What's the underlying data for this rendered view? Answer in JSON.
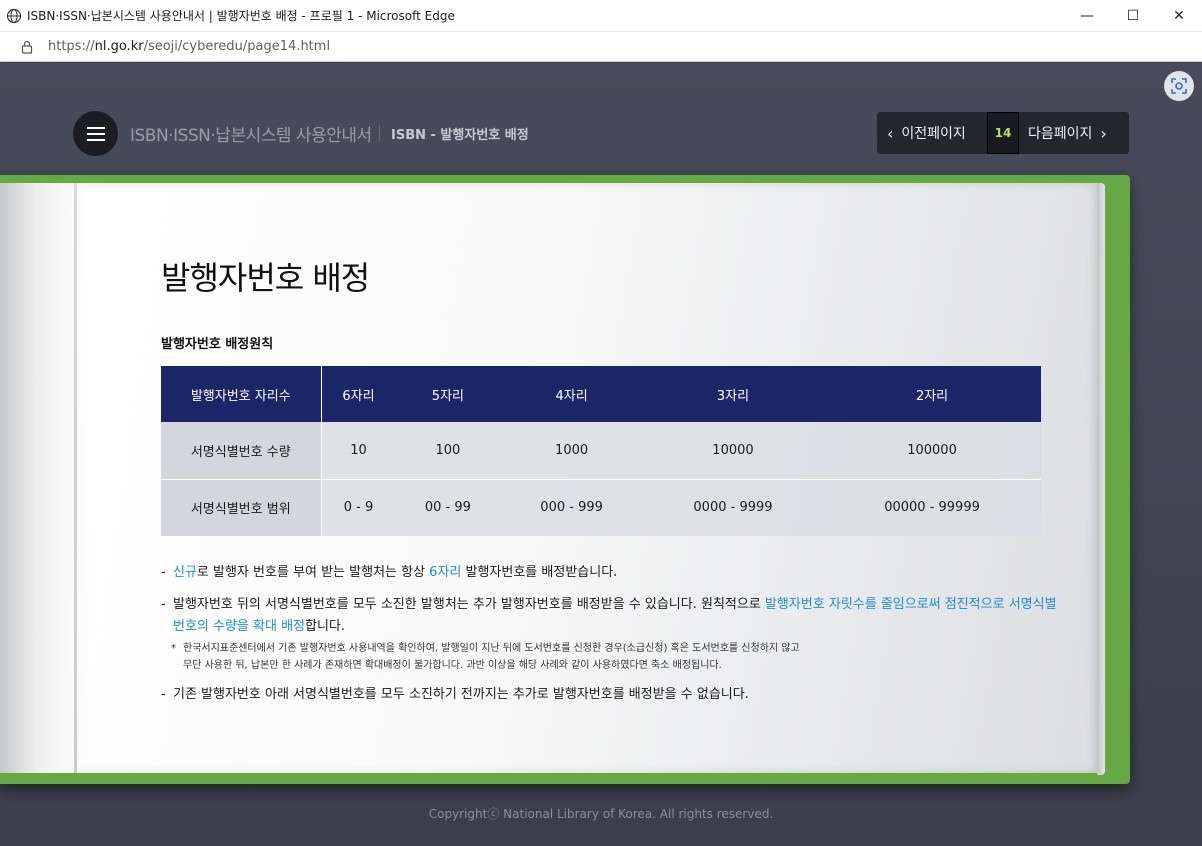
{
  "browser": {
    "window_title": "ISBN·ISSN·납본시스템 사용안내서 | 발행자번호 배정 - 프로필 1 - Microsoft Edge",
    "url_prefix": "https://",
    "url_domain": "nl.go.kr",
    "url_path": "/seoji/cyberedu/page14.html",
    "minimize_glyph": "—",
    "maximize_glyph": "☐",
    "close_glyph": "✕"
  },
  "header": {
    "site_title": "ISBN·ISSN·납본시스템 사용안내서",
    "section_title": "ISBN - 발행자번호 배정"
  },
  "pager": {
    "prev_label": "이전페이지",
    "page_number": "14",
    "next_label": "다음페이지",
    "prev_arrow": "‹",
    "next_arrow": "›"
  },
  "content": {
    "title": "발행자번호 배정",
    "subtitle": "발행자번호 배정원칙",
    "table": {
      "header_label": "발행자번호 자리수",
      "columns": [
        "6자리",
        "5자리",
        "4자리",
        "3자리",
        "2자리"
      ],
      "rows": [
        {
          "label": "서명식별번호 수량",
          "values": [
            "10",
            "100",
            "1000",
            "10000",
            "100000"
          ]
        },
        {
          "label": "서명식별번호 범위",
          "values": [
            "0 - 9",
            "00 - 99",
            "000 - 999",
            "0000 - 9999",
            "00000 - 99999"
          ]
        }
      ]
    },
    "notes": {
      "dash": "-",
      "n1_hl1": "신규",
      "n1_t1": "로 발행자 번호를 부여 받는 발행처는 항상 ",
      "n1_hl2": "6자리",
      "n1_t2": " 발행자번호를 배정받습니다.",
      "n2_t1": "발행자번호 뒤의 서명식별번호를 모두 소진한 발행처는 추가 발행자번호를 배정받을 수 있습니다.  원칙적으로 ",
      "n2_hl1": "발행자번호 자릿수를 줄임으로써 점진적으로 서명식별번호의 수량을 확대 배정",
      "n2_t2": "합니다.",
      "star": "*",
      "sub_line1": "한국서지표준센터에서 기존 발행자번호 사용내역을 확인하여, 발행일이 지난 뒤에 도서번호를 신청한 경우(소급신청) 혹은 도서번호를 신청하지 않고",
      "sub_line2": "무단 사용한 뒤, 납본만 한 사례가 존재하면 확대배정이 불가합니다. 과반 이상을 해당 사례와 같이 사용하였다면 축소 배정됩니다.",
      "n3": "기존 발행자번호 아래 서명식별번호를 모두 소진하기 전까지는 추가로 발행자번호를 배정받을 수 없습니다."
    }
  },
  "footer": {
    "copyright": "Copyrightⓒ National Library of Korea. All rights reserved."
  },
  "colors": {
    "table_header": "#1b2668",
    "highlight": "#1a8fd6",
    "book_cover": "#64a941",
    "page_number": "#b8e05a"
  }
}
